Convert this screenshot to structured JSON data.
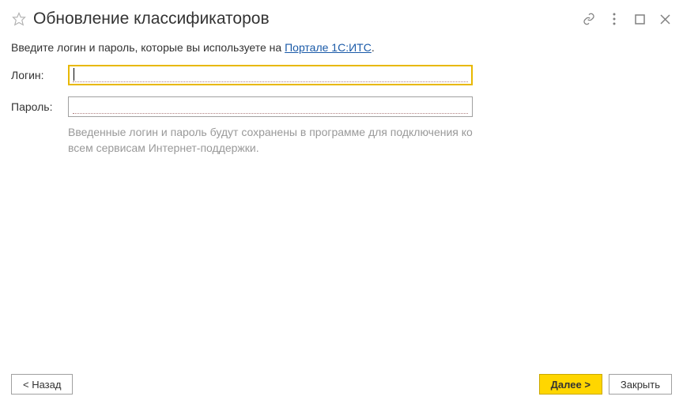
{
  "header": {
    "title": "Обновление классификаторов"
  },
  "intro": {
    "prefix": "Введите логин и пароль, которые вы используете на ",
    "link_text": "Портале 1С:ИТС",
    "suffix": "."
  },
  "form": {
    "login_label": "Логин:",
    "login_value": "",
    "password_label": "Пароль:",
    "password_value": ""
  },
  "hint": "Введенные логин и пароль будут сохранены в программе для подключения ко всем сервисам Интернет-поддержки.",
  "footer": {
    "back_label": "< Назад",
    "next_label": "Далее >",
    "close_label": "Закрыть"
  }
}
